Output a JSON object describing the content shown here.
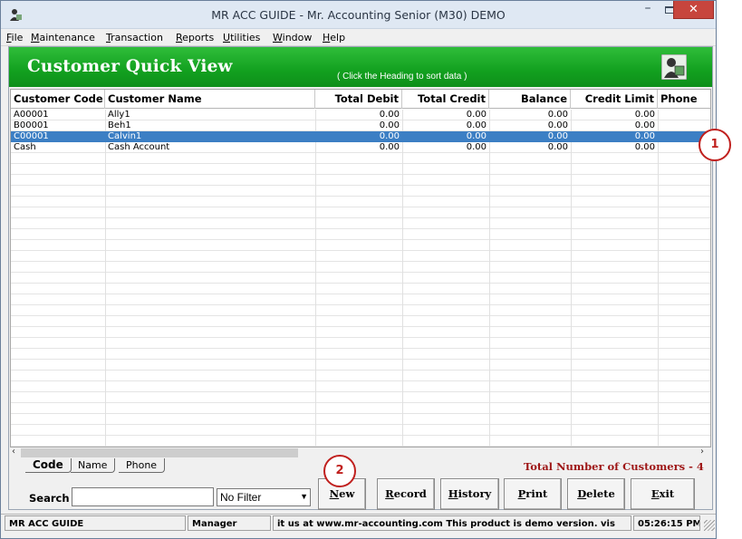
{
  "window": {
    "title": "MR ACC GUIDE - Mr. Accounting Senior (M30) DEMO",
    "minimize_glyph": "–",
    "close_glyph": "✕"
  },
  "menu": {
    "items": [
      "File",
      "Maintenance",
      "Transaction",
      "Reports",
      "Utilities",
      "Window",
      "Help"
    ]
  },
  "banner": {
    "title": "Customer Quick View",
    "hint": "( Click the Heading to sort data )"
  },
  "grid": {
    "columns": [
      "Customer Code",
      "Customer Name",
      "Total Debit",
      "Total Credit",
      "Balance",
      "Credit Limit",
      "Phone"
    ],
    "rows": [
      {
        "code": "A00001",
        "name": "Ally1",
        "debit": "0.00",
        "credit": "0.00",
        "balance": "0.00",
        "limit": "0.00"
      },
      {
        "code": "B00001",
        "name": "Beh1",
        "debit": "0.00",
        "credit": "0.00",
        "balance": "0.00",
        "limit": "0.00"
      },
      {
        "code": "C00001",
        "name": "Calvin1",
        "debit": "0.00",
        "credit": "0.00",
        "balance": "0.00",
        "limit": "0.00"
      },
      {
        "code": "Cash",
        "name": "Cash Account",
        "debit": "0.00",
        "credit": "0.00",
        "balance": "0.00",
        "limit": "0.00"
      }
    ],
    "selected_row": 2
  },
  "scrollbar": {
    "left_glyph": "‹",
    "right_glyph": "›"
  },
  "sort_tabs": [
    "Code",
    "Name",
    "Phone"
  ],
  "total_label": "Total Number of Customers - 4",
  "search": {
    "label": "Search",
    "value": ""
  },
  "filter": {
    "selected": "No Filter",
    "arrow_glyph": "▼"
  },
  "buttons": {
    "new": "New",
    "record": "Record",
    "history": "History",
    "print": "Print",
    "delete": "Delete",
    "exit": "Exit"
  },
  "status": {
    "app": "MR ACC GUIDE",
    "user": "Manager",
    "marquee": "it us at www.mr-accounting.com This product is demo version.  vis",
    "time": "05:26:15 PM"
  },
  "callouts": [
    "1",
    "2"
  ],
  "colors": {
    "banner": "#12a01f",
    "selection": "#3c7fc4",
    "close": "#c7453d",
    "callout": "#c0201e",
    "total": "#9e1616"
  }
}
